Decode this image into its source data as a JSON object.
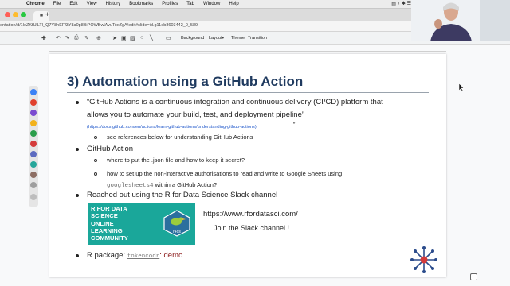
{
  "menubar": {
    "apple_glyph": "",
    "items": [
      "Chrome",
      "File",
      "Edit",
      "View",
      "History",
      "Bookmarks",
      "Profiles",
      "Tab",
      "Window",
      "Help"
    ],
    "status_glyphs": "▤ ◐ ✱ ☰"
  },
  "browser": {
    "tab_glyph": "■",
    "new_tab_glyph": "+",
    "url": "entation/d/1leZKfUlLTl_Q7Y8nEFf3Y8a0p8BiPOWBwlAvuToxZgA/edit#slide=id.g11eb8603442_0_589"
  },
  "toolbar": {
    "background_label": "Background",
    "layout_label": "Layout▾",
    "theme_label": "Theme",
    "transition_label": "Transition"
  },
  "slide": {
    "title": "3) Automation using a GitHub Action",
    "quote_line1": "“GitHub Actions is a continuous integration and continuous delivery (CI/CD) platform that",
    "quote_line2": "allows you to automate your build, test, and deployment pipeline”",
    "quote_link": "(https://docs.github.com/en/actions/learn-github-actions/understanding-github-actions)",
    "quote_link_tail": "”",
    "see_refs": "see references below for understanding GitHub Actions",
    "github_action": "GitHub Action",
    "q_json": "where to put the .json file and how to keep it secret?",
    "q_auth_line1": "how to set up the non-interactive authorisations to read and write to Google Sheets using",
    "q_auth_code": "googlesheets4",
    "q_auth_line2": " within a GitHub Action?",
    "reached_out": "Reached out using the R for Data Science Slack channel",
    "banner_lines": [
      "R FOR DATA",
      "SCIENCE",
      "ONLINE",
      "LEARNING",
      "COMMUNITY"
    ],
    "banner_logo_text": "r4ds",
    "site_url": "https://www.rfordatasci.com/",
    "join_slack": "Join the Slack channel !",
    "rpkg_label": "R package: ",
    "rpkg_code": "tokencodr",
    "rpkg_demo": ": demo"
  },
  "colors": {
    "title": "#1f3a5f",
    "link": "#1a53c9",
    "banner": "#1aa79a",
    "demo": "#8b1a1a"
  },
  "icons": [
    "apple-icon",
    "chrome-tab-icon",
    "new-tab-icon",
    "undo-icon",
    "redo-icon",
    "print-icon",
    "paint-format-icon",
    "zoom-icon",
    "select-cursor-icon",
    "text-box-icon",
    "image-icon",
    "shape-icon",
    "line-icon",
    "comment-icon",
    "mouse-cursor-icon",
    "r4ds-bird-logo",
    "r-community-emblem"
  ]
}
